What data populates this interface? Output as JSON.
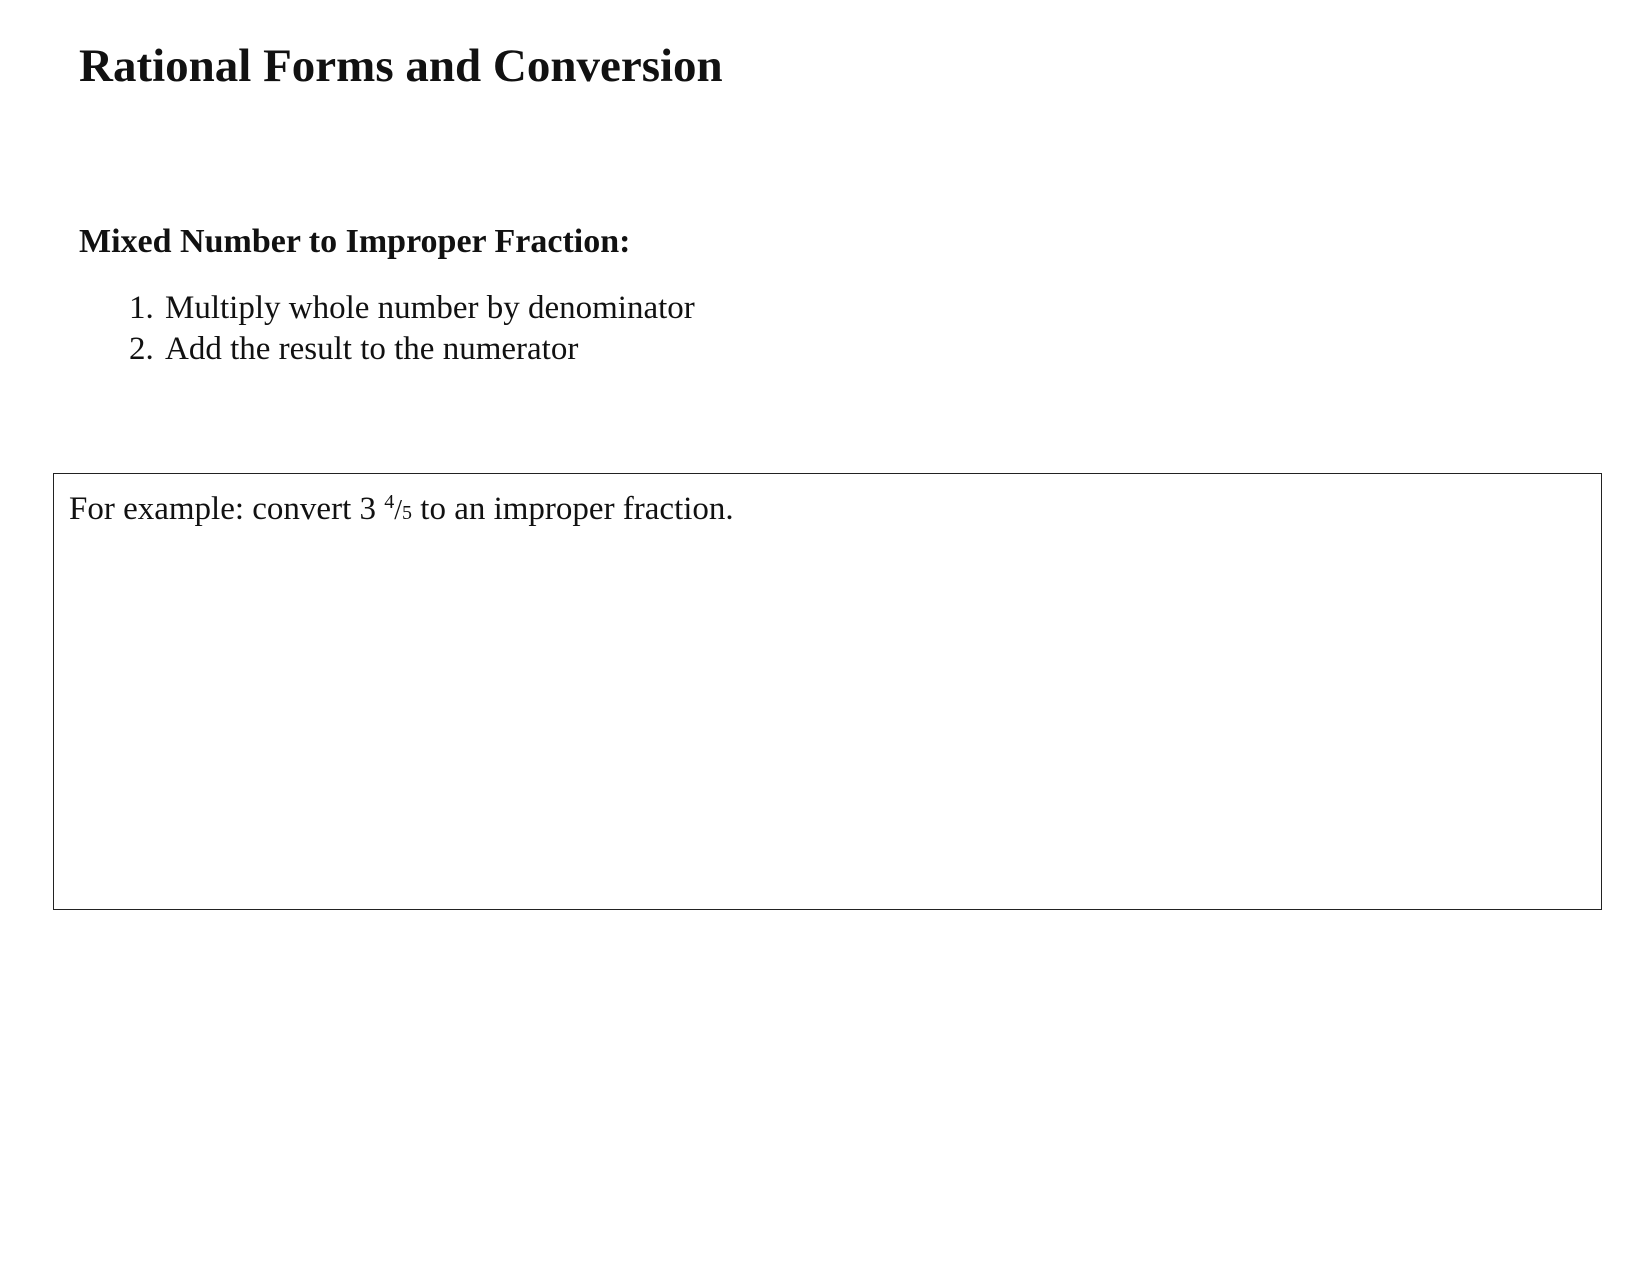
{
  "document": {
    "title": "Rational Forms and Conversion",
    "section": {
      "heading": "Mixed Number to Improper Fraction:",
      "steps": [
        {
          "number": "1.",
          "text": "Multiply whole number by denominator"
        },
        {
          "number": "2.",
          "text": "Add the result to the numerator"
        }
      ]
    },
    "example": {
      "prefix": "For example: convert 3 ",
      "fraction_numerator": "4",
      "fraction_slash": "/",
      "fraction_denominator": "5",
      "suffix": " to an improper fraction."
    }
  }
}
